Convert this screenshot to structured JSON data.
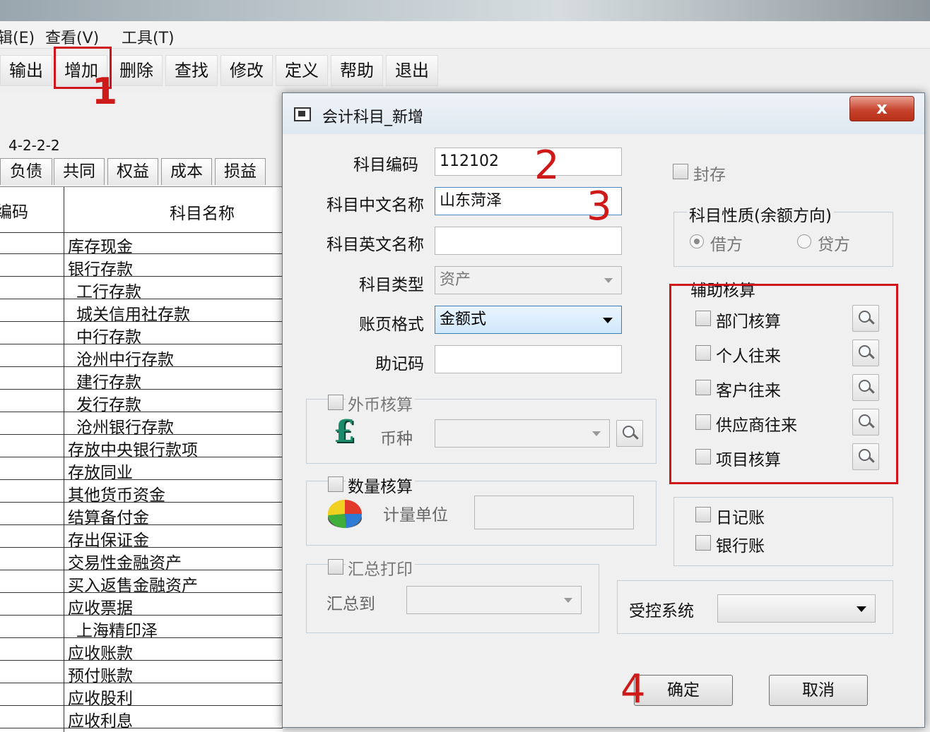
{
  "menu": [
    "辑(E)",
    "查看(V)",
    "工具(T)"
  ],
  "toolbar": [
    "输出",
    "增加",
    "删除",
    "查找",
    "修改",
    "定义",
    "帮助",
    "退出"
  ],
  "annotations": {
    "n1": "1",
    "n2": "2",
    "n3": "3",
    "n4": "4"
  },
  "level": "4-2-2-2",
  "tabs": [
    "负债",
    "共同",
    "权益",
    "成本",
    "损益"
  ],
  "grid": {
    "col_code": "编码",
    "col_name": "科目名称",
    "rows": [
      {
        "name": "库存现金",
        "indent": 0
      },
      {
        "name": "银行存款",
        "indent": 0
      },
      {
        "name": "工行存款",
        "indent": 1
      },
      {
        "name": "城关信用社存款",
        "indent": 1
      },
      {
        "name": "中行存款",
        "indent": 1
      },
      {
        "name": "沧州中行存款",
        "indent": 1
      },
      {
        "name": "建行存款",
        "indent": 1
      },
      {
        "name": "发行存款",
        "indent": 1
      },
      {
        "name": "沧州银行存款",
        "indent": 1
      },
      {
        "name": "存放中央银行款项",
        "indent": 0
      },
      {
        "name": "存放同业",
        "indent": 0
      },
      {
        "name": "其他货币资金",
        "indent": 0
      },
      {
        "name": "结算备付金",
        "indent": 0
      },
      {
        "name": "存出保证金",
        "indent": 0
      },
      {
        "name": "交易性金融资产",
        "indent": 0
      },
      {
        "name": "买入返售金融资产",
        "indent": 0
      },
      {
        "name": "应收票据",
        "indent": 0
      },
      {
        "name": "上海精印泽",
        "indent": 1
      },
      {
        "name": "应收账款",
        "indent": 0
      },
      {
        "name": "预付账款",
        "indent": 0
      },
      {
        "name": "应收股利",
        "indent": 0
      },
      {
        "name": "应收利息",
        "indent": 0
      }
    ]
  },
  "dialog": {
    "title": "会计科目_新增",
    "close": "x",
    "labels": {
      "code": "科目编码",
      "cn_name": "科目中文名称",
      "en_name": "科目英文名称",
      "type": "科目类型",
      "format": "账页格式",
      "mnemonic": "助记码"
    },
    "values": {
      "code": "112102",
      "cn_name": "山东菏泽",
      "en_name": "",
      "type": "资产",
      "format": "金额式",
      "mnemonic": ""
    },
    "sealed": "封存",
    "nature_title": "科目性质(余额方向)",
    "debit": "借方",
    "credit": "贷方",
    "aux_title": "辅助核算",
    "aux": [
      "部门核算",
      "个人往来",
      "客户往来",
      "供应商往来",
      "项目核算"
    ],
    "fx_title": "外币核算",
    "currency": "币种",
    "qty_title": "数量核算",
    "unit": "计量单位",
    "sum_title": "汇总打印",
    "sum_to": "汇总到",
    "journal": "日记账",
    "bank": "银行账",
    "controlled": "受控系统",
    "ok": "确定",
    "cancel": "取消"
  },
  "colors": {
    "annotation_red": "#d0141b",
    "close_red": "#c7442e",
    "focus_blue": "#cfe7fb"
  }
}
